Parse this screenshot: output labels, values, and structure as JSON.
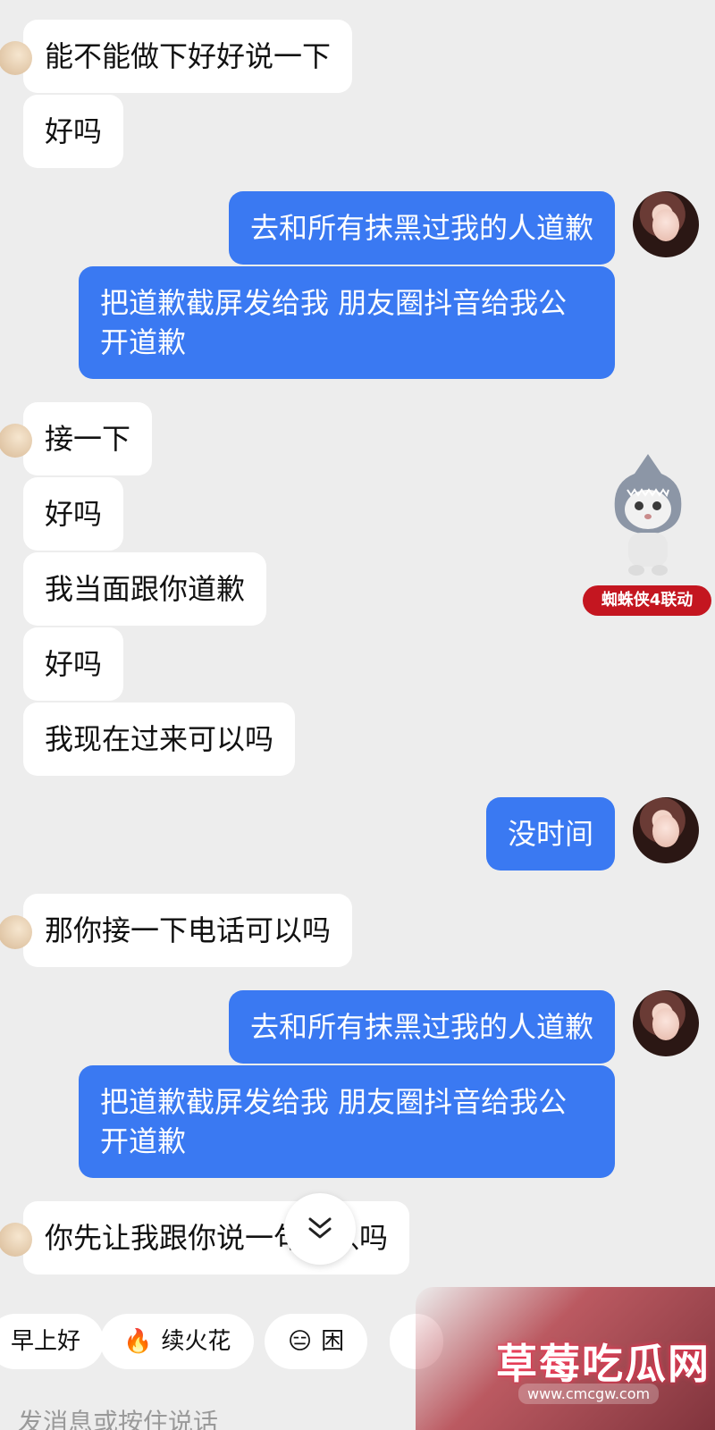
{
  "messages": [
    {
      "side": "in",
      "text": "能不能做下好好说一下"
    },
    {
      "side": "in",
      "text": "好吗"
    },
    {
      "side": "out",
      "text": "去和所有抹黑过我的人道歉"
    },
    {
      "side": "out",
      "text": "把道歉截屏发给我 朋友圈抖音给我公开道歉"
    },
    {
      "side": "in",
      "text": "接一下"
    },
    {
      "side": "in",
      "text": "好吗"
    },
    {
      "side": "in",
      "text": "我当面跟你道歉"
    },
    {
      "side": "in",
      "text": "好吗"
    },
    {
      "side": "in",
      "text": "我现在过来可以吗"
    },
    {
      "side": "out",
      "text": "没时间"
    },
    {
      "side": "in",
      "text": "那你接一下电话可以吗"
    },
    {
      "side": "out",
      "text": "去和所有抹黑过我的人道歉"
    },
    {
      "side": "out",
      "text": "把道歉截屏发给我 朋友圈抖音给我公开道歉"
    },
    {
      "side": "in",
      "text": "你先让我跟你说一句可以吗"
    }
  ],
  "sticker": {
    "badge": "蜘蛛侠4联动",
    "icon": "shark-cat-sticker"
  },
  "quick_replies": [
    {
      "label": "早上好"
    },
    {
      "label": "续火花",
      "icon": "🔥"
    },
    {
      "label": "困",
      "icon": "😑"
    }
  ],
  "input": {
    "placeholder": "发消息或按住说话"
  },
  "watermark": {
    "title": "草莓吃瓜网",
    "url": "www.cmcgw.com"
  },
  "colors": {
    "background": "#ededed",
    "outgoing_bubble": "#3a79f2",
    "incoming_bubble": "#ffffff"
  }
}
